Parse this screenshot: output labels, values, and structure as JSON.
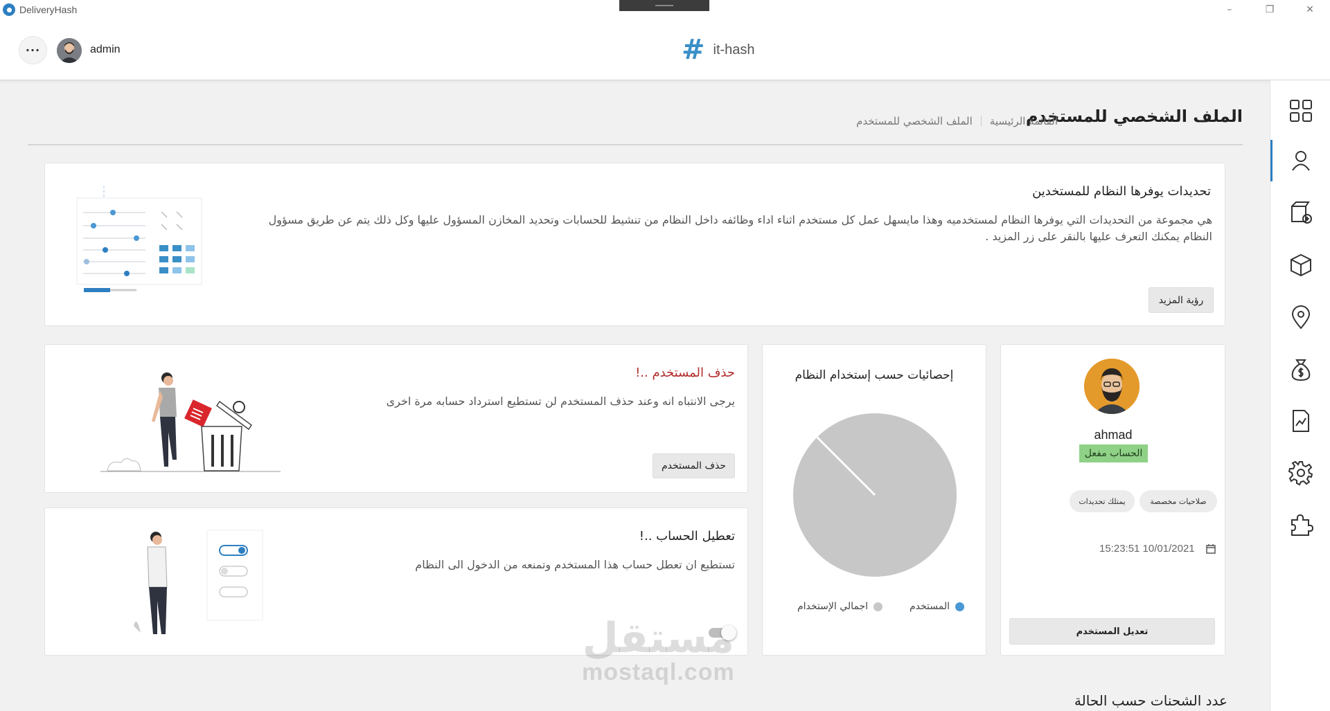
{
  "window": {
    "title": "DeliveryHash",
    "controls": [
      "minimize",
      "maximize",
      "close"
    ]
  },
  "header": {
    "user_name": "admin",
    "brand_name": "it-hash",
    "more_icon": "ellipsis-icon"
  },
  "page": {
    "title": "الملف الشخصي للمستخدم",
    "breadcrumb": [
      "القائمة الرئيسية",
      "الملف الشخصي للمستخدم"
    ]
  },
  "sidebar": {
    "items": [
      {
        "icon": "dashboard-grid-icon",
        "active": false
      },
      {
        "icon": "user-icon",
        "active": true
      },
      {
        "icon": "add-package-icon",
        "active": false
      },
      {
        "icon": "package-box-icon",
        "active": false
      },
      {
        "icon": "location-pin-icon",
        "active": false
      },
      {
        "icon": "money-bag-icon",
        "active": false
      },
      {
        "icon": "report-chart-icon",
        "active": false
      },
      {
        "icon": "settings-gear-icon",
        "active": false
      },
      {
        "icon": "plugin-puzzle-icon",
        "active": false
      }
    ]
  },
  "updates": {
    "title": "تحديدات يوفرها النظام للمستخدين",
    "text": "هي مجموعة من التحديدات التي يوفرها النظام لمستخدميه وهذا مايسهل عمل كل مستخدم اثناء اداء وظائفه داخل النظام من تنشيط للحسابات وتحديد المخازن المسؤول عليها وكل ذلك يتم عن طريق مسؤول النظام يمكنك التعرف عليها بالنقر على زر المزيد .",
    "more_button": "رؤية المزيد"
  },
  "profile": {
    "name": "ahmad",
    "status": "الحساب مفعل",
    "chips": [
      "صلاحيات مخصصة",
      "يمتلك تحديدات"
    ],
    "datetime": "15:23:51 10/01/2021",
    "edit_button": "تعديل المستخدم"
  },
  "stats": {
    "title": "إحصائيات حسب إستخدام النظام",
    "legend": [
      {
        "label": "المستخدم",
        "color": "#4a98d4"
      },
      {
        "label": "اجمالي الإستخدام",
        "color": "#c7c7c7"
      }
    ]
  },
  "chart_data": {
    "type": "pie",
    "title": "إحصائيات حسب إستخدام النظام",
    "categories": [
      "المستخدم",
      "اجمالي الإستخدام"
    ],
    "values": [
      0,
      100
    ],
    "colors": [
      "#4a98d4",
      "#c7c7c7"
    ],
    "legend": "bottom"
  },
  "delete_user": {
    "title": "حذف المستخدم ..!",
    "text": "يرجى الانتباه انه وعند حذف المستخدم لن تستطيع استرداد حسابه مرة اخرى",
    "button": "حذف المستخدم",
    "title_color": "#b22a2a"
  },
  "disable_account": {
    "title": "تعطيل الحساب ..!",
    "text": "تستطيع ان تعطل حساب هذا المستخدم وتمنعه من الدخول الى النظام",
    "toggle_on": false
  },
  "shipments": {
    "title": "عدد الشحنات حسب الحالة"
  },
  "watermark": {
    "arabic": "مستقل",
    "latin": "mostaql.com"
  }
}
